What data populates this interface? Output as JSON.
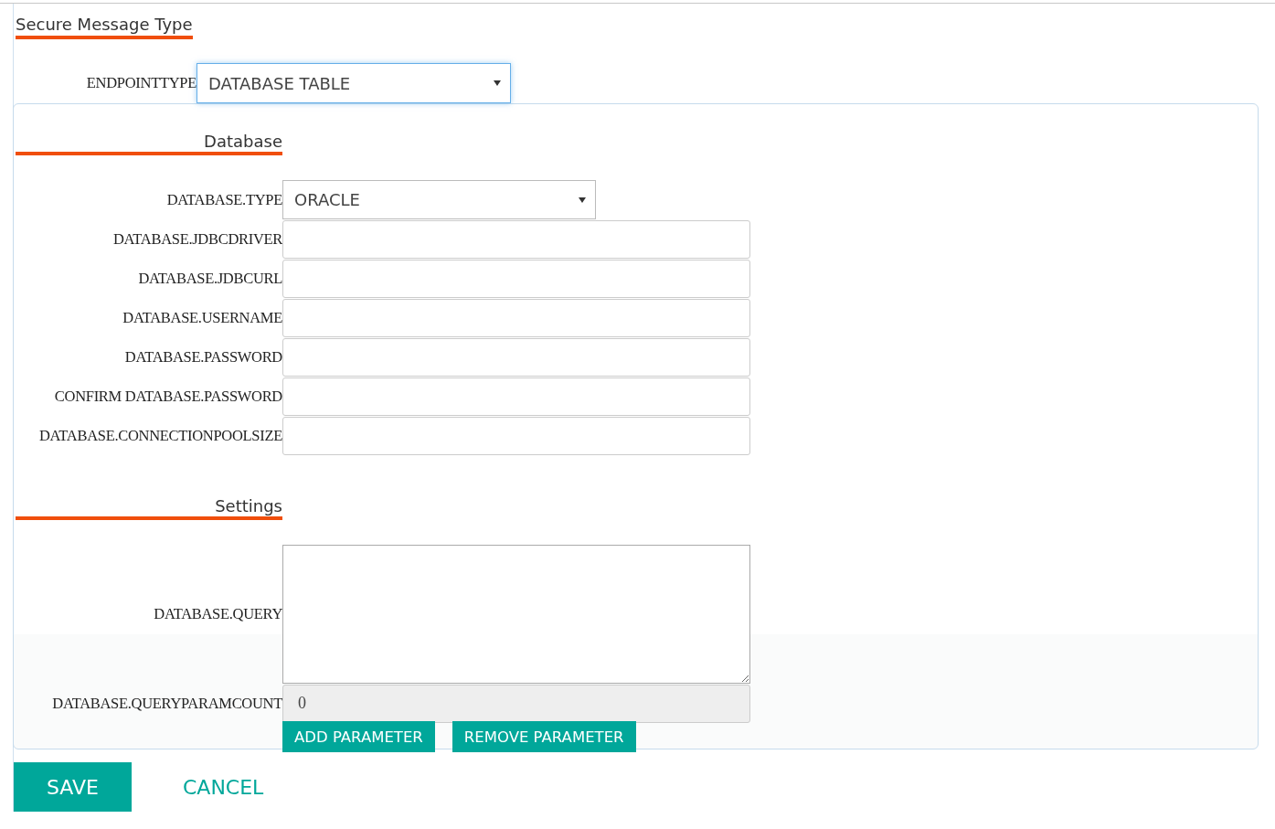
{
  "title": "Secure Message Type",
  "endpoint": {
    "label": "ENDPOINTTYPE",
    "value": "DATABASE TABLE",
    "focused": true
  },
  "sections": [
    {
      "heading": "Database",
      "fields": [
        {
          "kind": "select",
          "label": "DATABASE.TYPE",
          "value": "ORACLE"
        },
        {
          "kind": "text",
          "label": "DATABASE.JDBCDRIVER"
        },
        {
          "kind": "text",
          "label": "DATABASE.JDBCURL"
        },
        {
          "kind": "text",
          "label": "DATABASE.USERNAME"
        },
        {
          "kind": "text",
          "label": "DATABASE.PASSWORD"
        },
        {
          "kind": "text",
          "label": "CONFIRM DATABASE.PASSWORD"
        },
        {
          "kind": "text",
          "label": "DATABASE.CONNECTIONPOOLSIZE"
        }
      ]
    },
    {
      "heading": "Settings",
      "fields": [
        {
          "kind": "textarea",
          "label": "DATABASE.QUERY"
        },
        {
          "kind": "readonly",
          "label": "DATABASE.QUERYPARAMCOUNT",
          "value": "0"
        }
      ]
    }
  ],
  "param_buttons": [
    "ADD PARAMETER",
    "REMOVE PARAMETER"
  ],
  "actions": [
    {
      "kind": "primary",
      "label": "SAVE"
    },
    {
      "kind": "link",
      "label": "CANCEL"
    }
  ]
}
